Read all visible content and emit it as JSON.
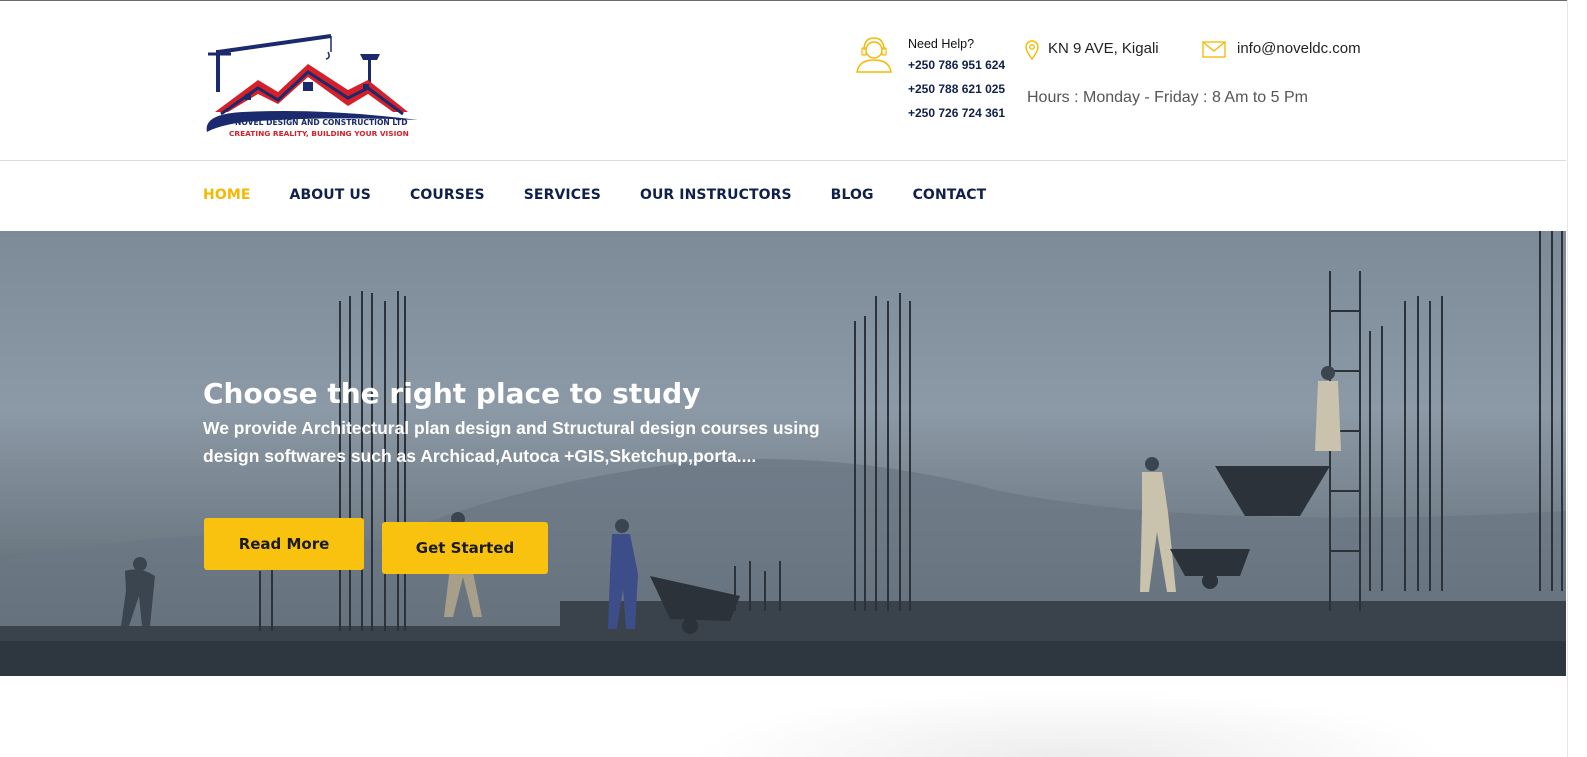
{
  "header": {
    "help_title": "Need Help?",
    "phones": [
      "+250 786 951 624",
      "+250 788 621 025",
      "+250 726 724 361"
    ],
    "address": "KN 9 AVE, Kigali",
    "email": "info@noveldc.com",
    "hours": "Hours : Monday - Friday : 8 Am to 5 Pm",
    "logo": {
      "name": "NOVEL DESIGN AND CONSTRUCTION LTD",
      "tagline": "CREATING REALITY, BUILDING YOUR VISION"
    }
  },
  "nav": {
    "items": [
      "HOME",
      "ABOUT US",
      "COURSES",
      "SERVICES",
      "OUR INSTRUCTORS",
      "BLOG",
      "CONTACT"
    ],
    "active": "HOME"
  },
  "hero": {
    "title": "Choose the right place to study",
    "subtitle": "We provide Architectural plan design and Structural design courses using design softwares such as Archicad,Autoca +GIS,Sketchup,porta....",
    "read_more": "Read More",
    "get_started": "Get Started"
  },
  "colors": {
    "accent": "#f8c20f",
    "nav_text": "#10204b",
    "logo_red": "#d5202a",
    "logo_navy": "#1a2a6c"
  },
  "icons": [
    "headset-icon",
    "map-pin-icon",
    "envelope-icon"
  ]
}
